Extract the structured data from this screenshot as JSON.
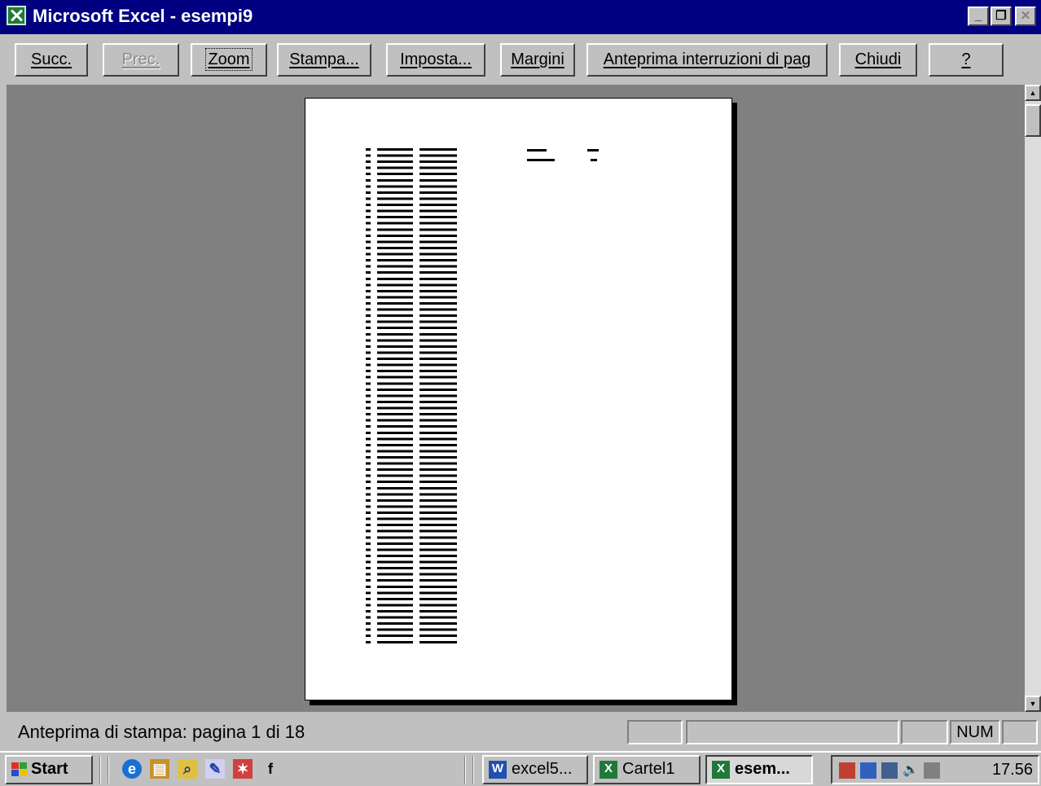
{
  "window": {
    "title": "Microsoft Excel - esempi9"
  },
  "toolbar": {
    "next": "Succ.",
    "prev": "Prec.",
    "zoom": "Zoom",
    "print": "Stampa...",
    "setup": "Imposta...",
    "margins": "Margini",
    "page_break_preview": "Anteprima interruzioni di pag",
    "close": "Chiudi",
    "help": "?"
  },
  "status": {
    "text": "Anteprima di stampa: pagina 1 di 18",
    "num": "NUM"
  },
  "taskbar": {
    "start": "Start",
    "tasks": [
      "excel5...",
      "Cartel1",
      "esem..."
    ],
    "clock": "17.56"
  }
}
